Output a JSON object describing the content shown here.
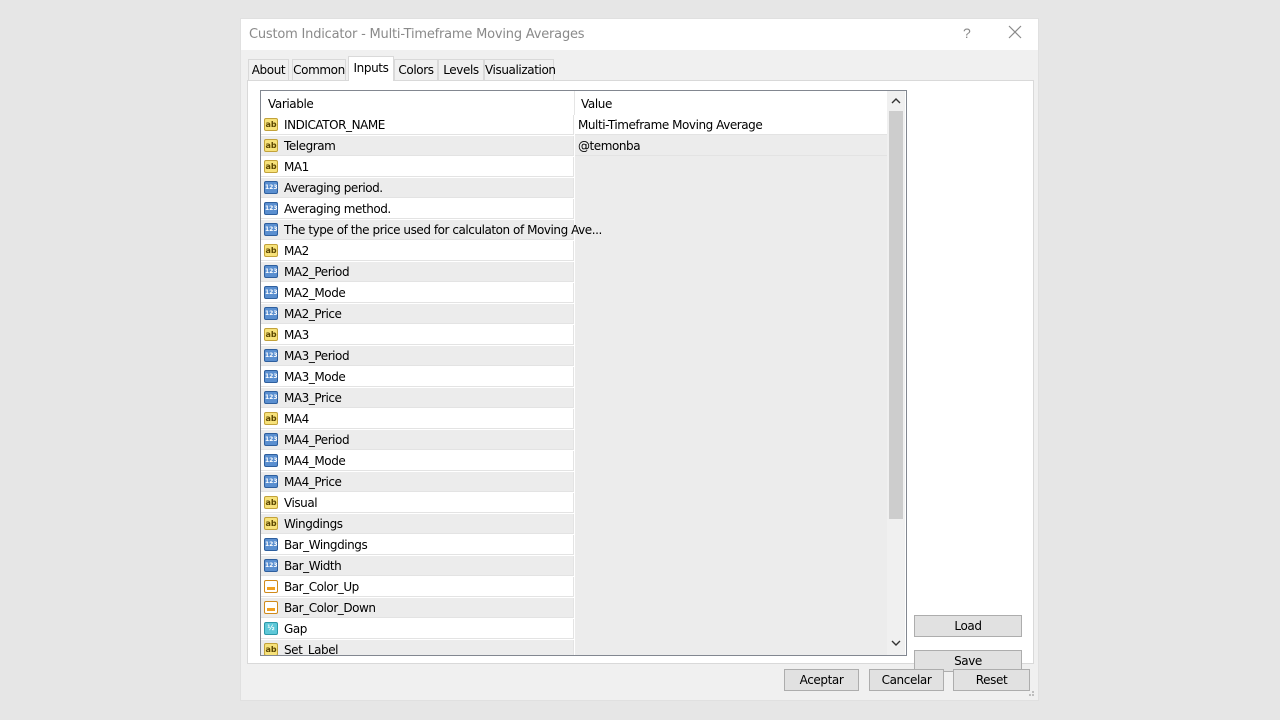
{
  "window": {
    "title": "Custom Indicator - Multi-Timeframe Moving Averages",
    "help_label": "?"
  },
  "tabs": [
    {
      "label": "About",
      "active": false
    },
    {
      "label": "Common",
      "active": false
    },
    {
      "label": "Inputs",
      "active": true
    },
    {
      "label": "Colors",
      "active": false
    },
    {
      "label": "Levels",
      "active": false
    },
    {
      "label": "Visualization",
      "active": false
    }
  ],
  "grid": {
    "headers": {
      "variable": "Variable",
      "value": "Value"
    },
    "rows": [
      {
        "icon": "ab",
        "icon_name": "string-type-icon",
        "variable": "INDICATOR_NAME",
        "value": "Multi-Timeframe Moving Average"
      },
      {
        "icon": "ab",
        "icon_name": "string-type-icon",
        "variable": "Telegram",
        "value": "@temonba"
      },
      {
        "icon": "ab",
        "icon_name": "string-type-icon",
        "variable": "MA1",
        "value": ""
      },
      {
        "icon": "num",
        "icon_name": "integer-type-icon",
        "variable": "Averaging period.",
        "value": ""
      },
      {
        "icon": "num",
        "icon_name": "integer-type-icon",
        "variable": "Averaging method.",
        "value": ""
      },
      {
        "icon": "num",
        "icon_name": "integer-type-icon",
        "variable": "The type of the price used for calculaton of Moving Ave...",
        "value": ""
      },
      {
        "icon": "ab",
        "icon_name": "string-type-icon",
        "variable": "MA2",
        "value": ""
      },
      {
        "icon": "num",
        "icon_name": "integer-type-icon",
        "variable": "MA2_Period",
        "value": ""
      },
      {
        "icon": "num",
        "icon_name": "integer-type-icon",
        "variable": "MA2_Mode",
        "value": ""
      },
      {
        "icon": "num",
        "icon_name": "integer-type-icon",
        "variable": "MA2_Price",
        "value": ""
      },
      {
        "icon": "ab",
        "icon_name": "string-type-icon",
        "variable": "MA3",
        "value": ""
      },
      {
        "icon": "num",
        "icon_name": "integer-type-icon",
        "variable": "MA3_Period",
        "value": ""
      },
      {
        "icon": "num",
        "icon_name": "integer-type-icon",
        "variable": "MA3_Mode",
        "value": ""
      },
      {
        "icon": "num",
        "icon_name": "integer-type-icon",
        "variable": "MA3_Price",
        "value": ""
      },
      {
        "icon": "ab",
        "icon_name": "string-type-icon",
        "variable": "MA4",
        "value": ""
      },
      {
        "icon": "num",
        "icon_name": "integer-type-icon",
        "variable": "MA4_Period",
        "value": ""
      },
      {
        "icon": "num",
        "icon_name": "integer-type-icon",
        "variable": "MA4_Mode",
        "value": ""
      },
      {
        "icon": "num",
        "icon_name": "integer-type-icon",
        "variable": "MA4_Price",
        "value": ""
      },
      {
        "icon": "ab",
        "icon_name": "string-type-icon",
        "variable": "Visual",
        "value": ""
      },
      {
        "icon": "ab",
        "icon_name": "string-type-icon",
        "variable": "Wingdings",
        "value": ""
      },
      {
        "icon": "num",
        "icon_name": "integer-type-icon",
        "variable": "Bar_Wingdings",
        "value": ""
      },
      {
        "icon": "num",
        "icon_name": "integer-type-icon",
        "variable": "Bar_Width",
        "value": ""
      },
      {
        "icon": "color",
        "icon_name": "color-type-icon",
        "variable": "Bar_Color_Up",
        "value": ""
      },
      {
        "icon": "color",
        "icon_name": "color-type-icon",
        "variable": "Bar_Color_Down",
        "value": ""
      },
      {
        "icon": "dbl",
        "icon_name": "double-type-icon",
        "variable": "Gap",
        "value": ""
      },
      {
        "icon": "ab",
        "icon_name": "string-type-icon",
        "variable": "Set_Label",
        "value": ""
      }
    ]
  },
  "icons": {
    "ab": "ab",
    "num": "123",
    "dbl": "½",
    "color": ""
  },
  "side_buttons": {
    "load": "Load",
    "save": "Save"
  },
  "footer_buttons": {
    "accept": "Aceptar",
    "cancel": "Cancelar",
    "reset": "Reset"
  }
}
